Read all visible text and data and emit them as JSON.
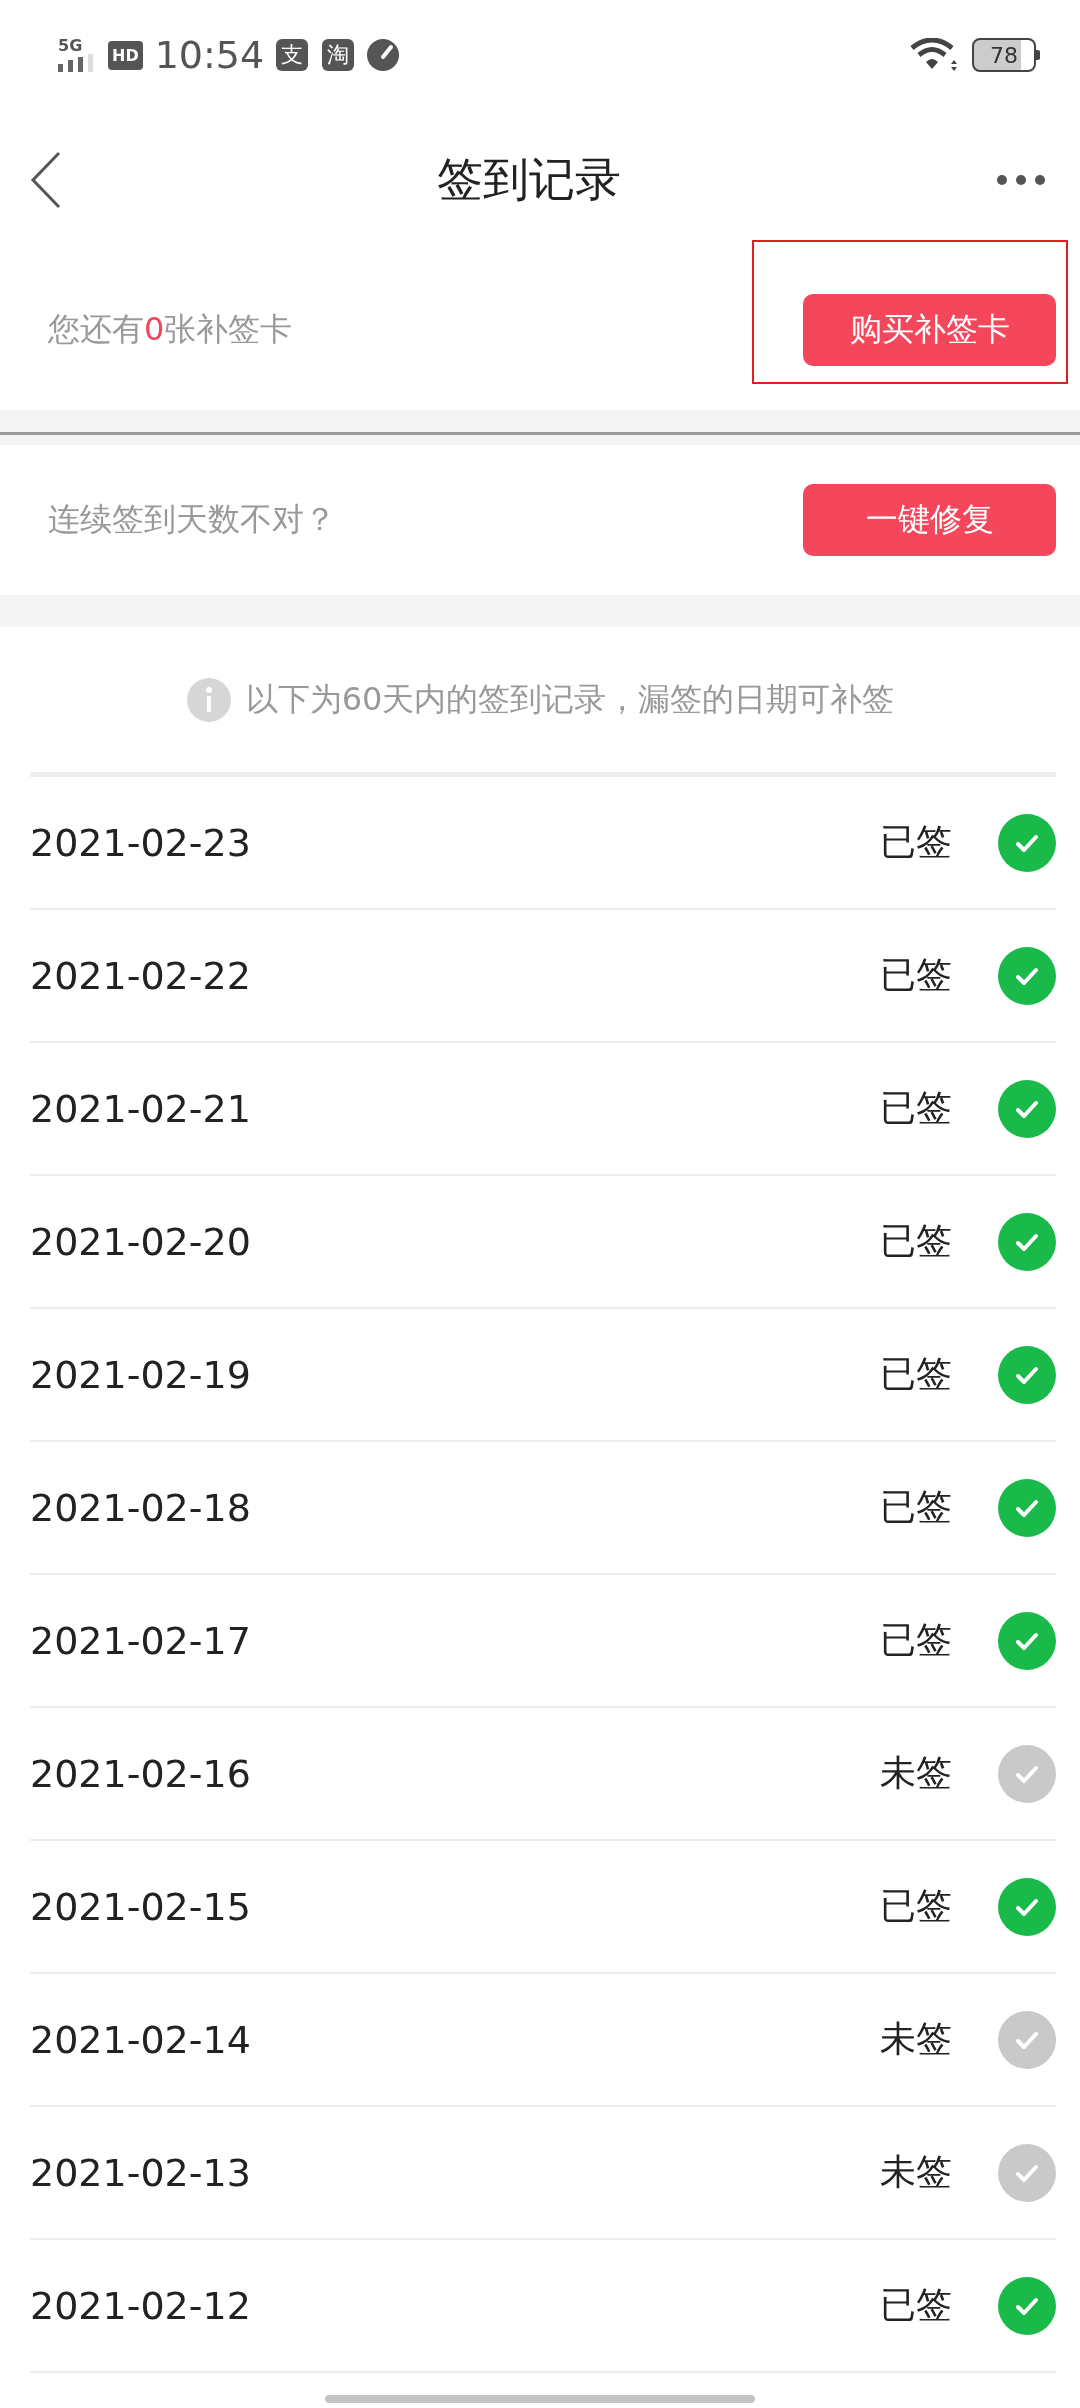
{
  "status_bar": {
    "network": "5G",
    "hd": "HD",
    "time": "10:54",
    "app_icons": [
      "支",
      "淘"
    ],
    "battery": "78"
  },
  "header": {
    "title": "签到记录"
  },
  "cards_summary": {
    "text": "您还有**0**张补签卡",
    "button": "购买补签卡",
    "highlighted": true
  },
  "repair": {
    "text": "连续签到天数不对？",
    "button": "一键修复"
  },
  "notice": "以下为60天内的签到记录，漏签的日期可补签",
  "records": [
    {
      "date": "2021-02-23",
      "status": "已签",
      "signed": true
    },
    {
      "date": "2021-02-22",
      "status": "已签",
      "signed": true
    },
    {
      "date": "2021-02-21",
      "status": "已签",
      "signed": true
    },
    {
      "date": "2021-02-20",
      "status": "已签",
      "signed": true
    },
    {
      "date": "2021-02-19",
      "status": "已签",
      "signed": true
    },
    {
      "date": "2021-02-18",
      "status": "已签",
      "signed": true
    },
    {
      "date": "2021-02-17",
      "status": "已签",
      "signed": true
    },
    {
      "date": "2021-02-16",
      "status": "未签",
      "signed": false
    },
    {
      "date": "2021-02-15",
      "status": "已签",
      "signed": true
    },
    {
      "date": "2021-02-14",
      "status": "未签",
      "signed": false
    },
    {
      "date": "2021-02-13",
      "status": "未签",
      "signed": false
    },
    {
      "date": "2021-02-12",
      "status": "已签",
      "signed": true
    }
  ]
}
